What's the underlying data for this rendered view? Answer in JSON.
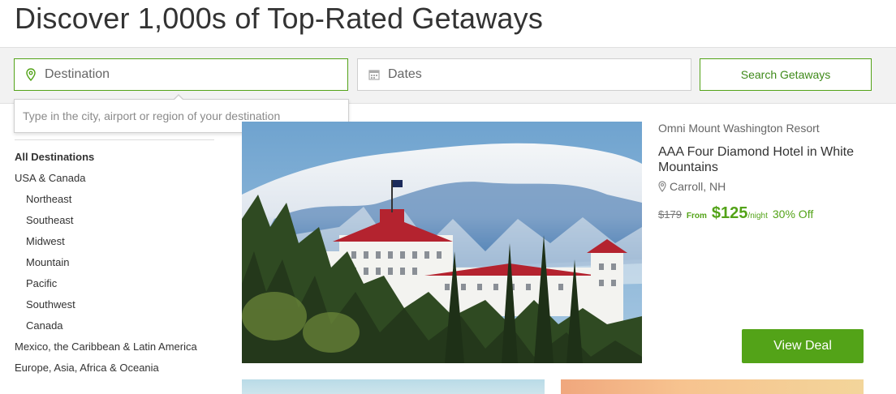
{
  "page": {
    "title": "Discover 1,000s of Top-Rated Getaways"
  },
  "search": {
    "destination_placeholder": "Destination",
    "dates_placeholder": "Dates",
    "button_label": "Search Getaways",
    "dropdown_hint": "Type in the city, airport or region of your destination",
    "destination_icon": "map-pin-icon",
    "dates_icon": "calendar-icon"
  },
  "sidebar": {
    "items": [
      {
        "label": "All Destinations",
        "level": 0,
        "bold": true
      },
      {
        "label": "USA & Canada",
        "level": 0
      },
      {
        "label": "Northeast",
        "level": 1
      },
      {
        "label": "Southeast",
        "level": 1
      },
      {
        "label": "Midwest",
        "level": 1
      },
      {
        "label": "Mountain",
        "level": 1
      },
      {
        "label": "Pacific",
        "level": 1
      },
      {
        "label": "Southwest",
        "level": 1
      },
      {
        "label": "Canada",
        "level": 1
      },
      {
        "label": "Mexico, the Caribbean & Latin America",
        "level": 0
      },
      {
        "label": "Europe, Asia, Africa & Oceania",
        "level": 0
      }
    ]
  },
  "deal": {
    "merchant": "Omni Mount Washington Resort",
    "title": "AAA Four Diamond Hotel in White Mountains",
    "location": "Carroll, NH",
    "location_icon": "map-pin-icon",
    "original_price": "$179",
    "from_label": "From",
    "price": "$125",
    "per_label": "/night",
    "discount": "30% Off",
    "button_label": "View Deal"
  },
  "colors": {
    "accent": "#53a318",
    "text": "#333333",
    "muted": "#666666"
  }
}
